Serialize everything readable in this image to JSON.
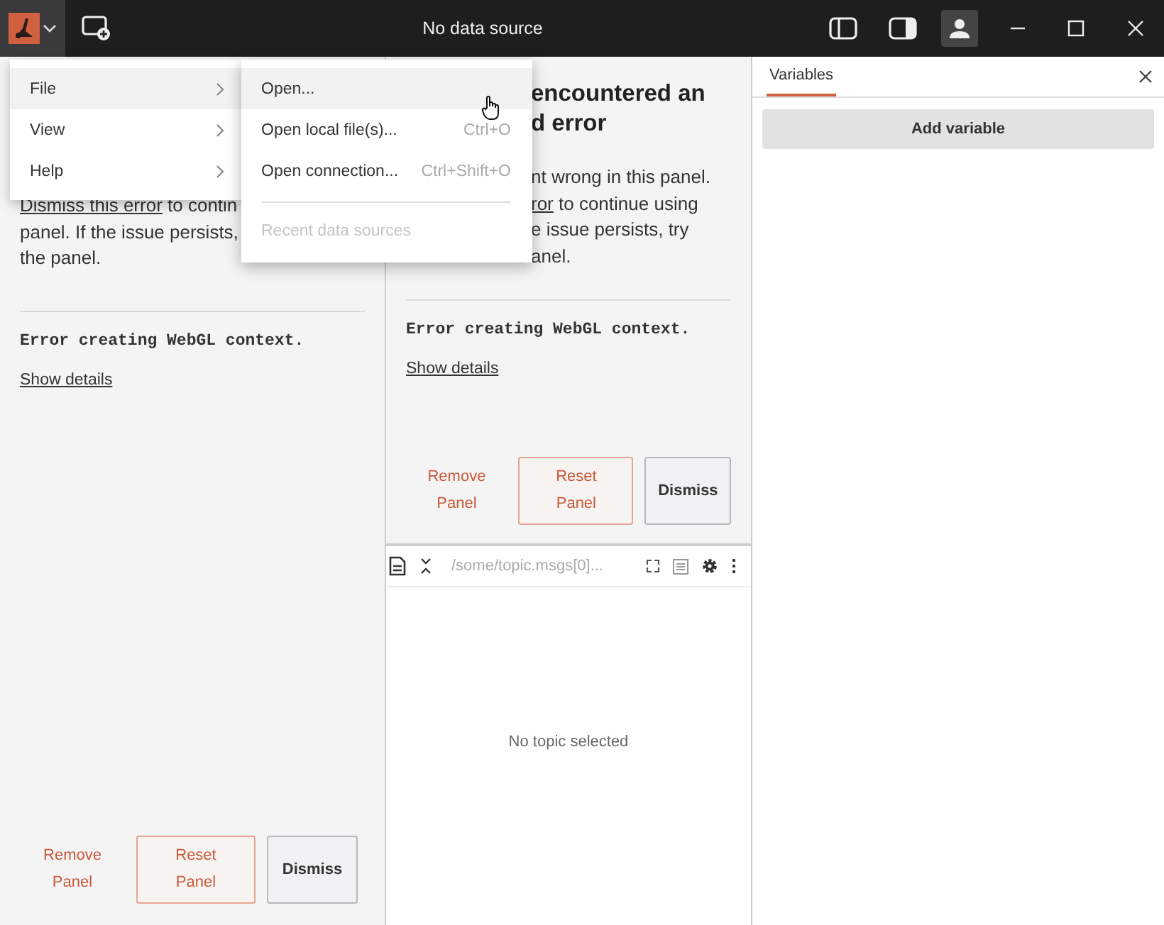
{
  "title_bar": {
    "title": "No data source"
  },
  "menu": {
    "items": [
      {
        "label": "File",
        "selected": true
      },
      {
        "label": "View",
        "selected": false
      },
      {
        "label": "Help",
        "selected": false
      }
    ]
  },
  "submenu": {
    "items": [
      {
        "label": "Open...",
        "selected": true,
        "disabled": false
      },
      {
        "label": "Open local file(s)...",
        "shortcut": "Ctrl+O",
        "selected": false,
        "disabled": false
      },
      {
        "label": "Open connection...",
        "shortcut": "Ctrl+Shift+O",
        "selected": false,
        "disabled": false
      },
      {
        "label": "Recent data sources",
        "selected": false,
        "disabled": true
      }
    ]
  },
  "left_panel": {
    "message": [
      {
        "link": "Dismiss this error",
        "text": " to contin"
      },
      {
        "text": "panel. If the issue persists,"
      },
      {
        "text": "the panel."
      }
    ],
    "error": "Error creating WebGL context.",
    "details_link": "Show details",
    "buttons": [
      "Remove Panel",
      "Reset Panel",
      "Dismiss"
    ]
  },
  "middle_panel": {
    "heading": [
      "encountered an",
      "d error"
    ],
    "message": [
      {
        "text": "nt wrong in this panel."
      },
      {
        "link": "ror",
        "text": " to continue using"
      },
      {
        "text": "e issue persists, try"
      },
      {
        "text": "anel."
      }
    ],
    "error": "Error creating WebGL context.",
    "details_link": "Show details",
    "buttons": [
      "Remove Panel",
      "Reset Panel",
      "Dismiss"
    ]
  },
  "plot_panel": {
    "topic": "/some/topic.msgs[0]...",
    "empty_text": "No topic selected"
  },
  "sidebar": {
    "tabs": [
      {
        "label": "Variables",
        "selected": true
      }
    ],
    "add_button": "Add variable"
  }
}
